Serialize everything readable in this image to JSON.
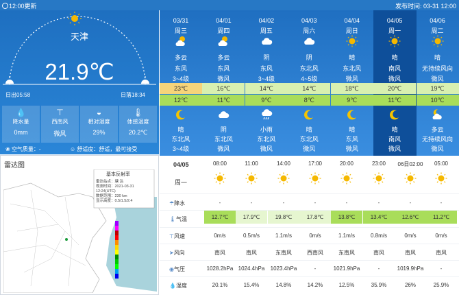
{
  "topbar": {
    "update": "12:00更新",
    "publish": "发布时间:  03-31 12:00"
  },
  "current": {
    "city": "天津",
    "temperature": "21.9℃",
    "sunrise": "日出05:58",
    "sunset": "日落18:34",
    "tiles": [
      {
        "icon": "raindrop-icon",
        "label": "降水量",
        "value": "0mm"
      },
      {
        "icon": "wind-icon",
        "label": "西南风",
        "value": "微风"
      },
      {
        "icon": "humidity-icon",
        "label": "相对湿度",
        "value": "29%"
      },
      {
        "icon": "thermometer-icon",
        "label": "体感温度",
        "value": "20.2℃"
      }
    ],
    "aqi": "空气质量：-",
    "comfort": "舒适度：舒适，最可接受"
  },
  "radar": {
    "title": "雷达图",
    "map_title": "基本反射率",
    "legend_text": [
      "雷达站点：塘 沽",
      "观测时间：2021-03-31",
      "   12:24(UTC)",
      "数据范围：230 km",
      "显示高度：0.5/1.5/2.4"
    ]
  },
  "forecast": [
    {
      "date": "03/31",
      "weekday": "周三",
      "day_cond": "多云",
      "day_dir": "东风",
      "day_speed": "3~4级",
      "high": "23℃",
      "low": "12℃",
      "night_cond": "晴",
      "night_dir": "东北风",
      "night_speed": "3~4级",
      "day_icon": "partly-cloudy-icon",
      "night_icon": "moon-icon"
    },
    {
      "date": "04/01",
      "weekday": "周四",
      "day_cond": "多云",
      "day_dir": "东风",
      "day_speed": "微风",
      "high": "16℃",
      "low": "11℃",
      "night_cond": "阴",
      "night_dir": "东北风",
      "night_speed": "微风",
      "day_icon": "partly-cloudy-icon",
      "night_icon": "cloud-icon"
    },
    {
      "date": "04/02",
      "weekday": "周五",
      "day_cond": "阴",
      "day_dir": "东风",
      "day_speed": "3~4级",
      "high": "14℃",
      "low": "9℃",
      "night_cond": "小雨",
      "night_dir": "东北风",
      "night_speed": "微风",
      "day_icon": "cloud-icon",
      "night_icon": "rain-icon"
    },
    {
      "date": "04/03",
      "weekday": "周六",
      "day_cond": "阴",
      "day_dir": "东北风",
      "day_speed": "4~5级",
      "high": "14℃",
      "low": "8℃",
      "night_cond": "晴",
      "night_dir": "东北风",
      "night_speed": "微风",
      "day_icon": "cloud-icon",
      "night_icon": "moon-icon"
    },
    {
      "date": "04/04",
      "weekday": "周日",
      "day_cond": "晴",
      "day_dir": "东北风",
      "day_speed": "微风",
      "high": "18℃",
      "low": "9℃",
      "night_cond": "晴",
      "night_dir": "东风",
      "night_speed": "微风",
      "day_icon": "sun-icon",
      "night_icon": "moon-icon"
    },
    {
      "date": "04/05",
      "weekday": "周一",
      "day_cond": "晴",
      "day_dir": "南风",
      "day_speed": "微风",
      "high": "20℃",
      "low": "11℃",
      "night_cond": "晴",
      "night_dir": "南风",
      "night_speed": "微风",
      "day_icon": "sun-icon",
      "night_icon": "moon-icon"
    },
    {
      "date": "04/06",
      "weekday": "周二",
      "day_cond": "晴",
      "day_dir": "无持续风向",
      "day_speed": "微风",
      "high": "19℃",
      "low": "10℃",
      "night_cond": "多云",
      "night_dir": "无持续风向",
      "night_speed": "微风",
      "day_icon": "sun-icon",
      "night_icon": "partly-cloudy-night-icon"
    }
  ],
  "hourly": {
    "date": "04/05",
    "weekday": "周一",
    "labels": {
      "precip": "降水",
      "temp": "气温",
      "wind_speed": "风速",
      "wind_dir": "风向",
      "pressure": "气压",
      "humidity": "湿度"
    },
    "times": [
      "08:00",
      "11:00",
      "14:00",
      "17:00",
      "20:00",
      "23:00",
      "06日02:00",
      "05:00"
    ],
    "precip": [
      "-",
      "-",
      "-",
      "-",
      "-",
      "-",
      "-",
      "-"
    ],
    "temp": [
      "12.7℃",
      "17.9℃",
      "19.8℃",
      "17.8℃",
      "13.8℃",
      "13.4℃",
      "12.6℃",
      "11.2℃"
    ],
    "wind_speed": [
      "0m/s",
      "0.5m/s",
      "1.1m/s",
      "0m/s",
      "1.1m/s",
      "0.8m/s",
      "0m/s",
      "0m/s"
    ],
    "wind_dir": [
      "南风",
      "南风",
      "东南风",
      "西南风",
      "东南风",
      "南风",
      "南风",
      "南风"
    ],
    "pressure": [
      "1028.2hPa",
      "1024.4hPa",
      "1023.4hPa",
      "-",
      "1021.9hPa",
      "-",
      "1019.9hPa",
      "-"
    ],
    "humidity": [
      "20.1%",
      "15.4%",
      "14.8%",
      "14.2%",
      "12.5%",
      "35.9%",
      "26%",
      "25.9%"
    ]
  },
  "colors": {
    "blue": "#2778c5",
    "selected": "#0e4f9a",
    "high_band": "#d8f0b0",
    "low_band": "#a9dd5a",
    "today_high": "#f5d47a",
    "sun": "#f5b800"
  }
}
